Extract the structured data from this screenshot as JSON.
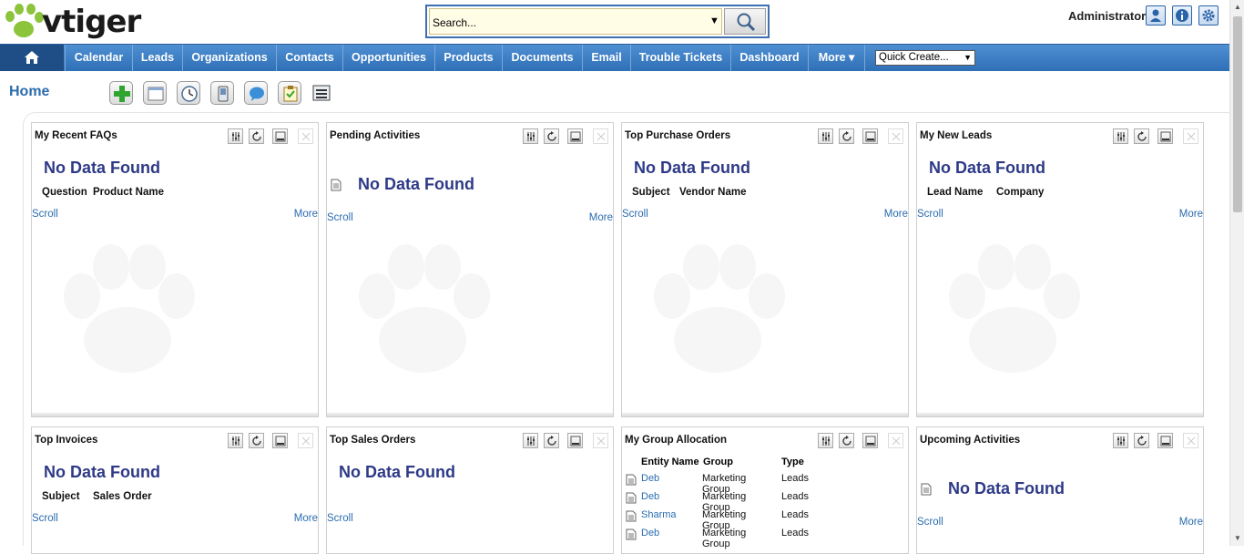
{
  "app": {
    "logo_text": "vtiger"
  },
  "header": {
    "search_value": "Search...",
    "user_name": "Administrator",
    "icons": [
      "user-profile-icon",
      "info-icon",
      "settings-icon"
    ]
  },
  "nav": {
    "items": [
      "Calendar",
      "Leads",
      "Organizations",
      "Contacts",
      "Opportunities",
      "Products",
      "Documents",
      "Email",
      "Trouble Tickets",
      "Dashboard",
      "More ▾"
    ],
    "quick_create": "Quick Create..."
  },
  "page": {
    "title": "Home"
  },
  "toolbar": {
    "icons": [
      "add-widget-icon",
      "window-icon",
      "clock-icon",
      "mobile-icon",
      "chat-icon",
      "clipboard-icon",
      "list-icon"
    ]
  },
  "widgets": {
    "recent_faqs": {
      "title": "My Recent FAQs",
      "nodata": "No Data Found",
      "col1": "Question",
      "col2": "Product Name",
      "scroll": "Scroll",
      "more": "More"
    },
    "pending_activities": {
      "title": "Pending Activities",
      "nodata": "No Data Found",
      "scroll": "Scroll",
      "more": "More"
    },
    "top_purchase_orders": {
      "title": "Top Purchase Orders",
      "nodata": "No Data Found",
      "col1": "Subject",
      "col2": "Vendor Name",
      "scroll": "Scroll",
      "more": "More"
    },
    "new_leads": {
      "title": "My New Leads",
      "nodata": "No Data Found",
      "col1": "Lead Name",
      "col2": "Company",
      "scroll": "Scroll",
      "more": "More"
    },
    "top_invoices": {
      "title": "Top Invoices",
      "nodata": "No Data Found",
      "col1": "Subject",
      "col2": "Sales Order",
      "scroll": "Scroll",
      "more": "More"
    },
    "top_sales_orders": {
      "title": "Top Sales Orders",
      "nodata": "No Data Found",
      "scroll": "Scroll"
    },
    "group_allocation": {
      "title": "My Group Allocation",
      "headers": [
        "Entity Name",
        "Group",
        "Type"
      ],
      "rows": [
        {
          "entity": "Deb",
          "group": "Marketing Group",
          "type": "Leads"
        },
        {
          "entity": "Deb",
          "group": "Marketing Group",
          "type": "Leads"
        },
        {
          "entity": "Sharma",
          "group": "Marketing Group",
          "type": "Leads"
        },
        {
          "entity": "Deb",
          "group": "Marketing Group",
          "type": "Leads"
        }
      ]
    },
    "upcoming_activities": {
      "title": "Upcoming Activities",
      "nodata": "No Data Found",
      "scroll": "Scroll",
      "more": "More"
    }
  },
  "colors": {
    "nav_top": "#4f8fd2",
    "nav_bottom": "#2f6fb6",
    "link": "#2b6cb0",
    "nodata": "#2e3a87"
  }
}
